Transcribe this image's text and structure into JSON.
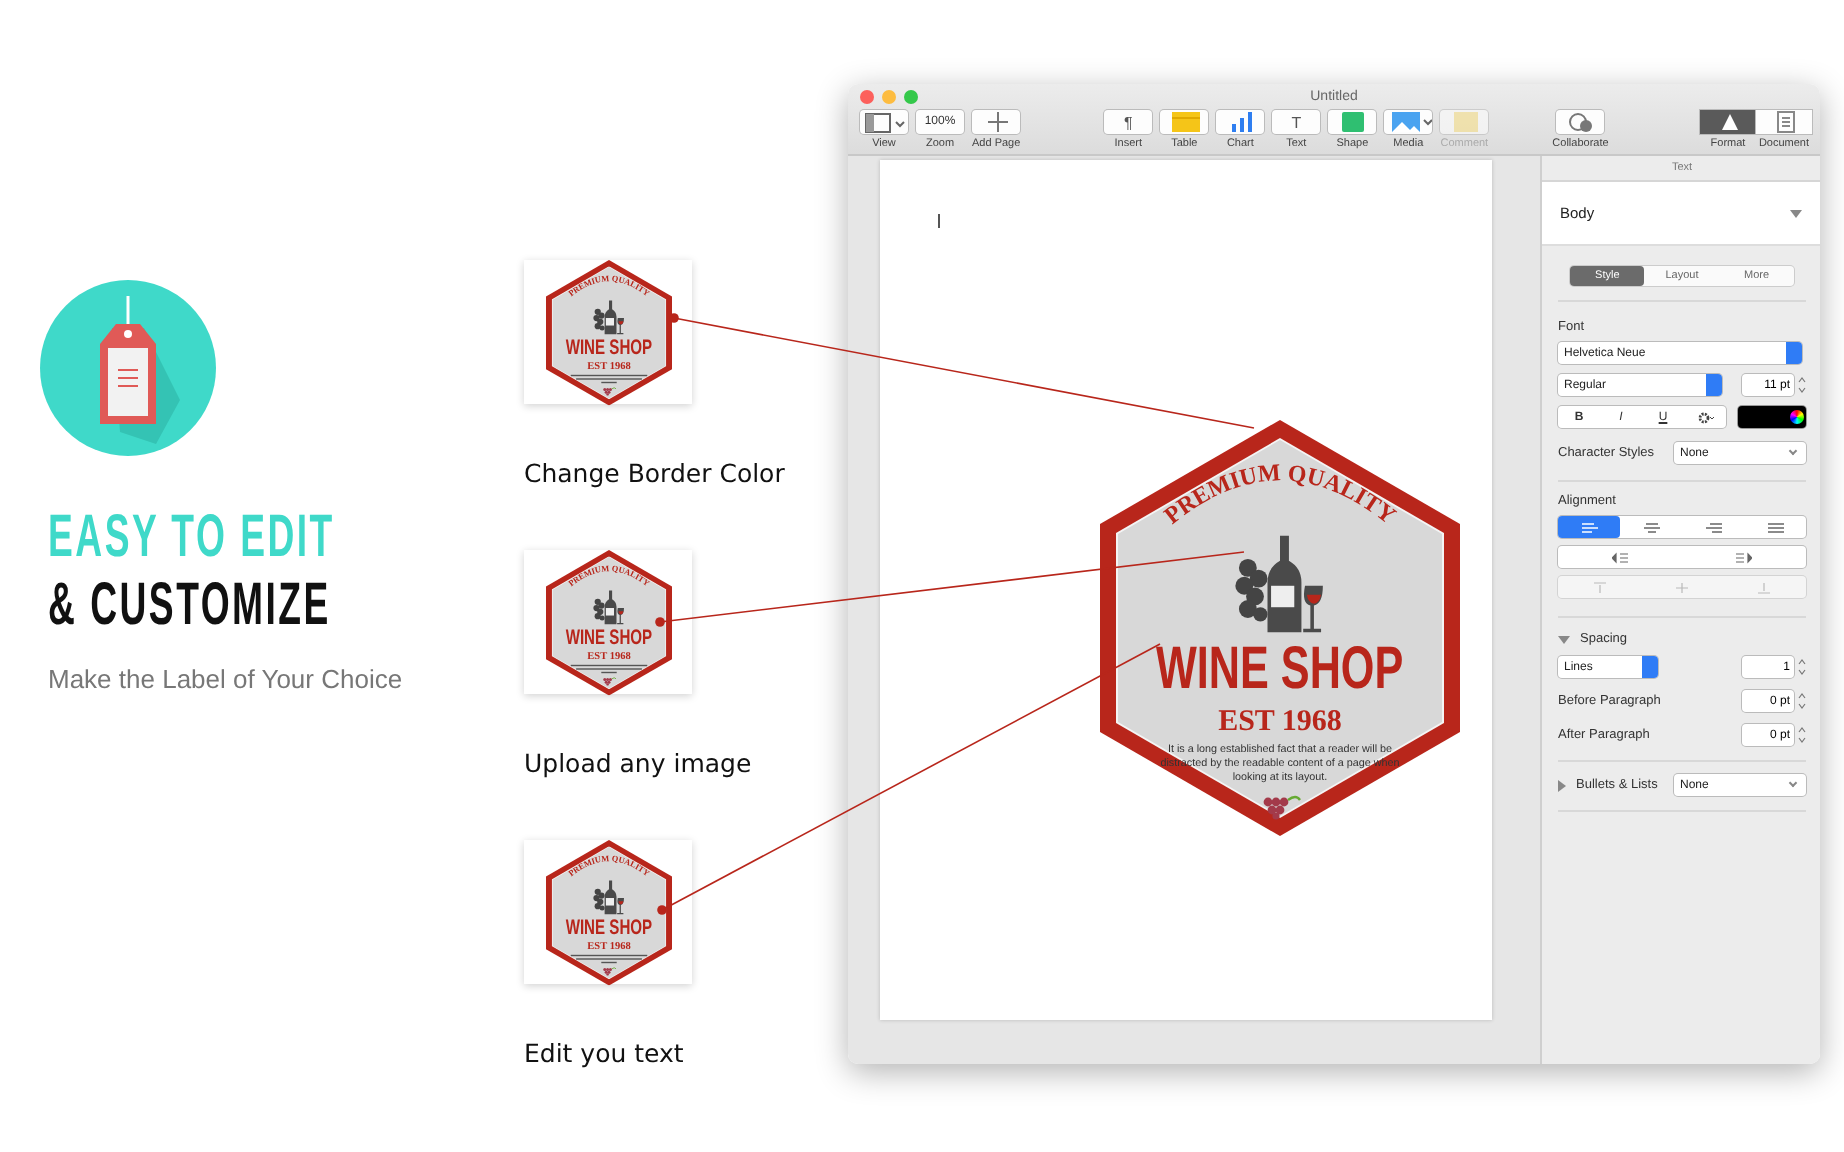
{
  "promo": {
    "title_line_1": "EASY TO EDIT",
    "title_line_2": "& CUSTOMIZE",
    "subtitle": "Make the Label of Your Choice"
  },
  "features": [
    {
      "caption": "Change Border Color",
      "label": {
        "arc_text": "PREMIUM QUALITY",
        "name": "WINE SHOP",
        "est": "EST 1968"
      }
    },
    {
      "caption": "Upload any image",
      "label": {
        "arc_text": "PREMIUM QUALITY",
        "name": "WINE SHOP",
        "est": "EST 1968"
      }
    },
    {
      "caption": "Edit you text",
      "label": {
        "arc_text": "PREMIUM QUALITY",
        "name": "WINE SHOP",
        "est": "EST 1968"
      }
    }
  ],
  "window": {
    "title": "Untitled",
    "toolbar": [
      {
        "label": "View",
        "kind": "view",
        "disabled": false
      },
      {
        "label": "Zoom",
        "kind": "zoom",
        "value": "100%",
        "disabled": false
      },
      {
        "label": "Add Page",
        "kind": "add",
        "disabled": false
      },
      {
        "label": "Insert",
        "kind": "glyph",
        "glyph": "¶",
        "disabled": false
      },
      {
        "label": "Table",
        "kind": "table",
        "disabled": false
      },
      {
        "label": "Chart",
        "kind": "chart",
        "disabled": false
      },
      {
        "label": "Text",
        "kind": "glyph",
        "glyph": "T",
        "disabled": false
      },
      {
        "label": "Shape",
        "kind": "shape",
        "disabled": false
      },
      {
        "label": "Media",
        "kind": "media",
        "disabled": false
      },
      {
        "label": "Comment",
        "kind": "comment",
        "disabled": true
      },
      {
        "label": "Collaborate",
        "kind": "collaborate",
        "disabled": false
      }
    ],
    "inspector_tabs": [
      {
        "label": "Format",
        "kind": "format",
        "selected": true
      },
      {
        "label": "Document",
        "kind": "document",
        "selected": false
      }
    ]
  },
  "document": {
    "label": {
      "arc_text": "PREMIUM QUALITY",
      "name": "WINE SHOP",
      "est": "EST 1968",
      "body": "It is a long established fact that a reader will be distracted by the readable content of a page when looking at its layout."
    }
  },
  "inspector": {
    "header": "Text",
    "paragraph_style": "Body",
    "tabs": [
      {
        "label": "Style",
        "selected": true
      },
      {
        "label": "Layout",
        "selected": false
      },
      {
        "label": "More",
        "selected": false
      }
    ],
    "font_label": "Font",
    "font_family": "Helvetica Neue",
    "font_style": "Regular",
    "font_size": "11 pt",
    "format_buttons": [
      {
        "kind": "bold",
        "glyph": "B"
      },
      {
        "kind": "italic",
        "glyph": "I"
      },
      {
        "kind": "underline",
        "glyph": "U"
      },
      {
        "kind": "gear"
      }
    ],
    "character_styles_label": "Character Styles",
    "character_style": "None",
    "alignment_label": "Alignment",
    "alignment": [
      {
        "kind": "left",
        "selected": true
      },
      {
        "kind": "center",
        "selected": false
      },
      {
        "kind": "right",
        "selected": false
      },
      {
        "kind": "justify",
        "selected": false
      }
    ],
    "spacing": {
      "label": "Spacing",
      "expanded": true,
      "line_mode": "Lines",
      "line_value": "1",
      "rows": [
        {
          "label": "Before Paragraph",
          "value": "0 pt"
        },
        {
          "label": "After Paragraph",
          "value": "0 pt"
        }
      ]
    },
    "bullets": {
      "label": "Bullets & Lists",
      "expanded": false,
      "value": "None"
    }
  }
}
